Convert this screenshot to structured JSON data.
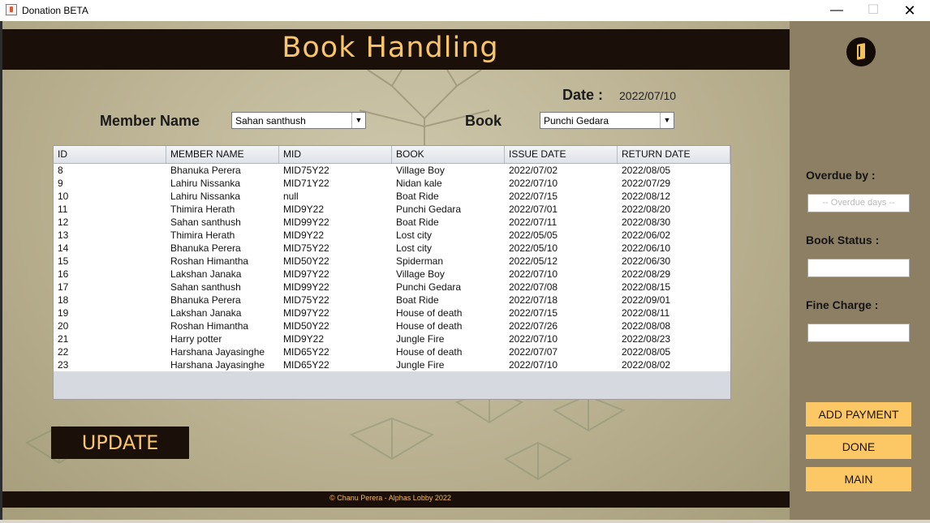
{
  "window": {
    "title": "Donation BETA",
    "minimize": "—",
    "maximize": "☐",
    "close": "✕"
  },
  "header": {
    "title": "Book Handling"
  },
  "date": {
    "label": "Date :",
    "value": "2022/07/10"
  },
  "form": {
    "member_label": "Member Name",
    "member_value": "Sahan santhush",
    "book_label": "Book",
    "book_value": "Punchi Gedara",
    "dropdown_glyph": "▼"
  },
  "table": {
    "columns": [
      "ID",
      "MEMBER NAME",
      "MID",
      "BOOK",
      "ISSUE DATE",
      "RETURN DATE"
    ],
    "rows": [
      [
        "8",
        "Bhanuka Perera",
        "MID75Y22",
        "Village Boy",
        "2022/07/02",
        "2022/08/05"
      ],
      [
        "9",
        "Lahiru Nissanka",
        "MID71Y22",
        "Nidan kale",
        "2022/07/10",
        "2022/07/29"
      ],
      [
        "10",
        "Lahiru Nissanka",
        "null",
        "Boat Ride",
        "2022/07/15",
        "2022/08/12"
      ],
      [
        "11",
        "Thimira Herath",
        "MID9Y22",
        "Punchi Gedara",
        "2022/07/01",
        "2022/08/20"
      ],
      [
        "12",
        "Sahan santhush",
        "MID99Y22",
        "Boat Ride",
        "2022/07/11",
        "2022/08/30"
      ],
      [
        "13",
        "Thimira Herath",
        "MID9Y22",
        "Lost city",
        "2022/05/05",
        "2022/06/02"
      ],
      [
        "14",
        "Bhanuka Perera",
        "MID75Y22",
        "Lost city",
        "2022/05/10",
        "2022/06/10"
      ],
      [
        "15",
        "Roshan Himantha",
        "MID50Y22",
        "Spiderman",
        "2022/05/12",
        "2022/06/30"
      ],
      [
        "16",
        "Lakshan Janaka",
        "MID97Y22",
        "Village Boy",
        "2022/07/10",
        "2022/08/29"
      ],
      [
        "17",
        "Sahan santhush",
        "MID99Y22",
        "Punchi Gedara",
        "2022/07/08",
        "2022/08/15"
      ],
      [
        "18",
        "Bhanuka Perera",
        "MID75Y22",
        "Boat Ride",
        "2022/07/18",
        "2022/09/01"
      ],
      [
        "19",
        "Lakshan Janaka",
        "MID97Y22",
        "House of death",
        "2022/07/15",
        "2022/08/11"
      ],
      [
        "20",
        "Roshan Himantha",
        "MID50Y22",
        "House of death",
        "2022/07/26",
        "2022/08/08"
      ],
      [
        "21",
        "Harry potter",
        "MID9Y22",
        "Jungle Fire",
        "2022/07/10",
        "2022/08/23"
      ],
      [
        "22",
        "Harshana Jayasinghe",
        "MID65Y22",
        "House of death",
        "2022/07/07",
        "2022/08/05"
      ],
      [
        "23",
        "Harshana Jayasinghe",
        "MID65Y22",
        "Jungle Fire",
        "2022/07/10",
        "2022/08/02"
      ]
    ]
  },
  "update_button": "UPDATE",
  "footer": "© Chanu Perera - Alphas Lobby 2022",
  "side": {
    "overdue_label": "Overdue by :",
    "overdue_placeholder": "-- Overdue days --",
    "status_label": "Book Status :",
    "status_value": "",
    "fine_label": "Fine Charge :",
    "fine_value": "",
    "buttons": {
      "add_payment": "ADD PAYMENT",
      "done": "DONE",
      "main": "MAIN"
    }
  },
  "colors": {
    "accent": "#f9c569",
    "dark_bar": "#1a0f09",
    "side_panel": "#8d7f63",
    "button": "#fcc866"
  }
}
